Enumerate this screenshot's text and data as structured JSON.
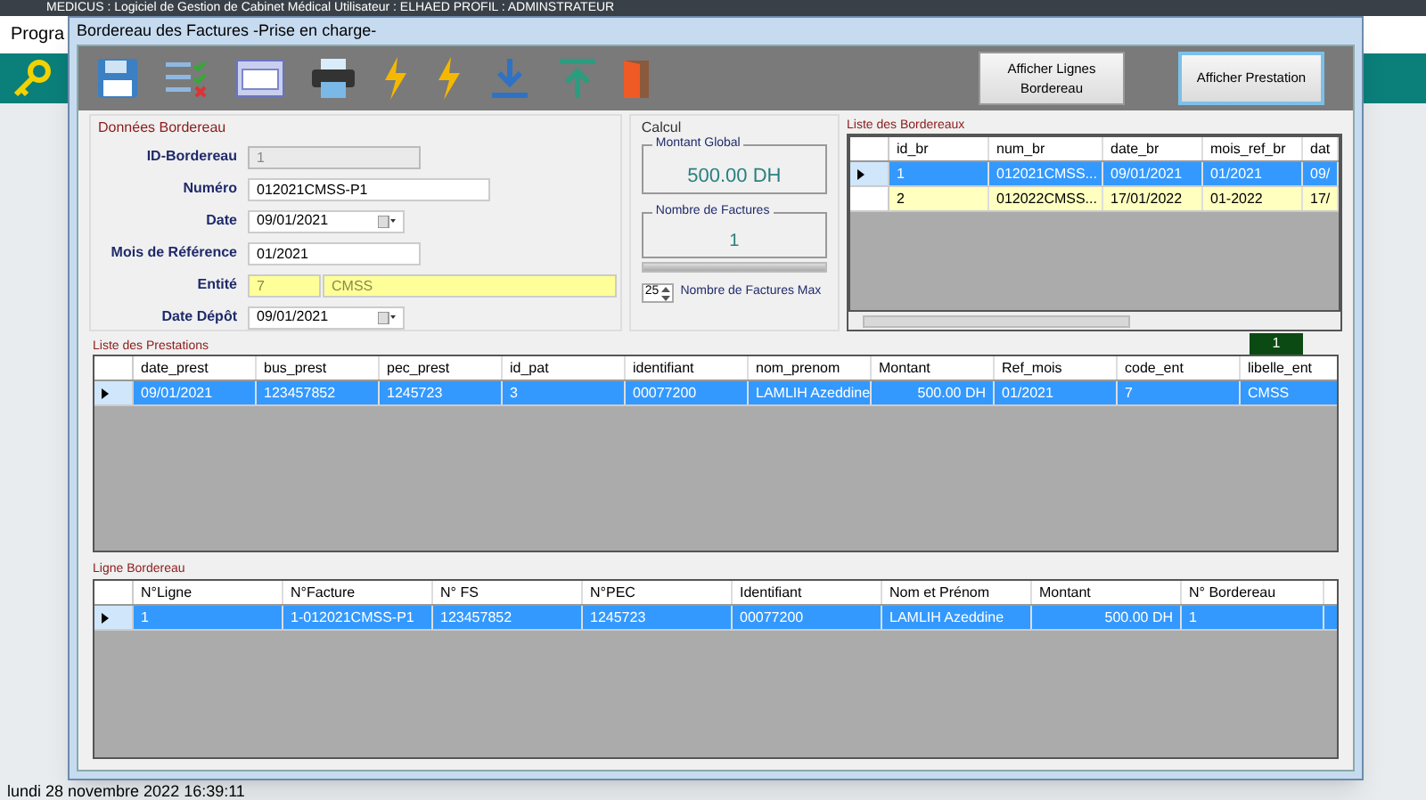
{
  "app": {
    "title": "MEDICUS : Logiciel de Gestion de Cabinet Médical     Utilisateur : ELHAED     PROFIL : ADMINSTRATEUR",
    "menu": [
      "Progra"
    ],
    "status_bar": "lundi 28 novembre 2022  16:39:11"
  },
  "window": {
    "title": "Bordereau des Factures -Prise en charge-"
  },
  "toolbar": [
    {
      "kind": "save"
    },
    {
      "kind": "checklist"
    },
    {
      "kind": "form"
    },
    {
      "kind": "print"
    },
    {
      "kind": "bolt"
    },
    {
      "kind": "bolt"
    },
    {
      "kind": "download"
    },
    {
      "kind": "upload"
    },
    {
      "kind": "exit"
    }
  ],
  "buttons": [
    {
      "label": "Afficher Lignes Bordereau",
      "focused": false
    },
    {
      "label": "Afficher Prestation",
      "focused": true
    }
  ],
  "donnees": {
    "title": "Données Bordereau",
    "fields": [
      {
        "label": "ID-Bordereau",
        "kind": "text",
        "value": "1",
        "disabled": true
      },
      {
        "label": "Numéro",
        "kind": "text",
        "value": "012021CMSS-P1",
        "disabled": false
      },
      {
        "label": "Date",
        "kind": "date",
        "value": "09/01/2021",
        "disabled": false
      },
      {
        "label": "Mois de Référence",
        "kind": "text",
        "value": "01/2021",
        "disabled": false
      },
      {
        "label": "Entité",
        "kind": "entity",
        "value": "7",
        "value2": "CMSS",
        "disabled": false
      },
      {
        "label": "Date Dépôt",
        "kind": "date",
        "value": "09/01/2021",
        "disabled": false
      }
    ]
  },
  "calcul": {
    "title": "Calcul",
    "montant_label": "Montant Global",
    "montant": "500.00 DH",
    "nombre_label": "Nombre de Factures",
    "nombre": "1",
    "progress": {
      "level": 0
    },
    "max_value": "25",
    "max_label": "Nombre de Factures Max"
  },
  "bordereaux": {
    "title": "Liste des Bordereaux",
    "columns": [
      "id_br",
      "num_br",
      "date_br",
      "mois_ref_br",
      "dat"
    ],
    "rows": [
      {
        "selected": true,
        "cells": [
          "1",
          "012021CMSS...",
          "09/01/2021",
          "01/2021",
          "09/"
        ]
      },
      {
        "selected": false,
        "cells": [
          "2",
          "012022CMSS...",
          "17/01/2022",
          "01-2022",
          "17/"
        ]
      }
    ]
  },
  "prestations": {
    "title": "Liste des Prestations",
    "count": "1",
    "columns": [
      {
        "label": "date_prest",
        "kind": "text"
      },
      {
        "label": "bus_prest",
        "kind": "text"
      },
      {
        "label": "pec_prest",
        "kind": "text"
      },
      {
        "label": "id_pat",
        "kind": "text"
      },
      {
        "label": "identifiant",
        "kind": "text"
      },
      {
        "label": "nom_prenom",
        "kind": "text"
      },
      {
        "label": "Montant",
        "kind": "amount"
      },
      {
        "label": "Ref_mois",
        "kind": "text"
      },
      {
        "label": "code_ent",
        "kind": "text"
      },
      {
        "label": "libelle_ent",
        "kind": "text"
      }
    ],
    "rows": [
      {
        "selected": true,
        "cells": [
          "09/01/2021",
          "123457852",
          "1245723",
          "3",
          "00077200",
          "LAMLIH Azeddine",
          "500.00 DH",
          "01/2021",
          "7",
          "CMSS"
        ]
      }
    ]
  },
  "lignes": {
    "title": "Ligne Bordereau",
    "columns": [
      {
        "label": "N°Ligne",
        "kind": "text"
      },
      {
        "label": "N°Facture",
        "kind": "text"
      },
      {
        "label": "N° FS",
        "kind": "text"
      },
      {
        "label": "N°PEC",
        "kind": "text"
      },
      {
        "label": "Identifiant",
        "kind": "text"
      },
      {
        "label": "Nom et Prénom",
        "kind": "text"
      },
      {
        "label": "Montant",
        "kind": "amount"
      },
      {
        "label": "N° Bordereau",
        "kind": "text"
      }
    ],
    "rows": [
      {
        "selected": true,
        "cells": [
          "1",
          "1-012021CMSS-P1",
          "123457852",
          "1245723",
          "00077200",
          "LAMLIH Azeddine",
          "500.00 DH",
          "1"
        ]
      }
    ]
  }
}
